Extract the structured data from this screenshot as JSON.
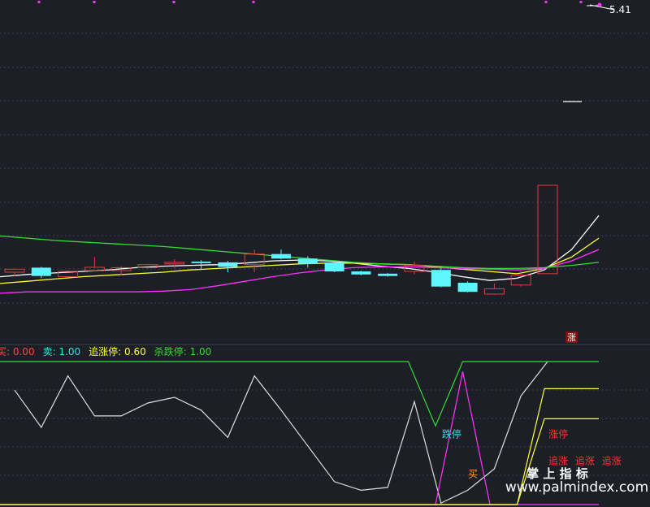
{
  "chart_data": [
    {
      "type": "candlestick",
      "price_label": "5.41",
      "limit_up_badge": "涨",
      "candles": [
        {
          "o": 0.0,
          "c": 0.4,
          "h": 0.5,
          "l": -0.5
        },
        {
          "o": 0.6,
          "c": -0.5,
          "h": 0.7,
          "l": -0.8
        },
        {
          "o": -0.6,
          "c": 0.1,
          "h": 0.25,
          "l": -0.7
        },
        {
          "o": 0.2,
          "c": 0.65,
          "h": 2.0,
          "l": 0.1
        },
        {
          "o": 0.2,
          "c": 0.6,
          "h": 0.8,
          "l": -0.4
        },
        {
          "o": 0.6,
          "c": 1.0,
          "h": 1.1,
          "l": 0.5
        },
        {
          "o": 1.1,
          "c": 1.3,
          "h": 1.7,
          "l": 0.5
        },
        {
          "o": 1.4,
          "c": 1.2,
          "h": 1.6,
          "l": 0.3
        },
        {
          "o": 1.3,
          "c": 0.7,
          "h": 1.5,
          "l": 0.0
        },
        {
          "o": 1.0,
          "c": 2.4,
          "h": 3.0,
          "l": 0.0
        },
        {
          "o": 2.4,
          "c": 1.8,
          "h": 3.0,
          "l": 1.7
        },
        {
          "o": 1.8,
          "c": 1.1,
          "h": 2.1,
          "l": 0.6
        },
        {
          "o": 1.3,
          "c": 0.1,
          "h": 1.4,
          "l": 0.0
        },
        {
          "o": 0.1,
          "c": -0.3,
          "h": 0.2,
          "l": -0.4
        },
        {
          "o": -0.2,
          "c": -0.5,
          "h": -0.1,
          "l": -0.6
        },
        {
          "o": 0.1,
          "c": 0.9,
          "h": 1.4,
          "l": -0.3
        },
        {
          "o": 0.3,
          "c": -1.9,
          "h": 0.6,
          "l": -2.0
        },
        {
          "o": -1.4,
          "c": -2.6,
          "h": -1.2,
          "l": -2.7
        },
        {
          "o": -2.9,
          "c": -2.2,
          "h": -1.5,
          "l": -3.0
        },
        {
          "o": -1.7,
          "c": -0.4,
          "h": 0.4,
          "l": -1.9
        },
        {
          "o": -0.2,
          "c": 11.5,
          "h": 11.5,
          "l": -0.2
        }
      ],
      "ma_lines": [
        {
          "color": "#ffffff",
          "values": [
            -0.6,
            -0.3,
            -0.1,
            0.1,
            0.3,
            0.6,
            0.8,
            0.9,
            1.0,
            1.2,
            1.5,
            1.6,
            1.5,
            1.2,
            0.8,
            0.5,
            0.0,
            -0.6,
            -1.1,
            -0.8,
            0.3,
            3.0,
            7.5
          ]
        },
        {
          "color": "#ffff33",
          "values": [
            -1.5,
            -1.2,
            -0.9,
            -0.6,
            -0.4,
            -0.2,
            0.0,
            0.3,
            0.5,
            0.7,
            0.9,
            1.1,
            1.2,
            1.2,
            1.1,
            1.0,
            0.7,
            0.4,
            0.1,
            -0.2,
            0.5,
            2.0,
            4.5
          ]
        },
        {
          "color": "#ff33ff",
          "values": [
            -2.8,
            -2.6,
            -2.6,
            -2.6,
            -2.6,
            -2.6,
            -2.5,
            -2.3,
            -1.8,
            -1.2,
            -0.6,
            -0.1,
            0.3,
            0.6,
            0.7,
            0.7,
            0.6,
            0.5,
            0.4,
            0.3,
            0.5,
            1.5,
            3.0
          ]
        },
        {
          "color": "#33dd33",
          "values": [
            4.8,
            4.5,
            4.2,
            4.0,
            3.8,
            3.6,
            3.4,
            3.1,
            2.8,
            2.5,
            2.2,
            1.9,
            1.6,
            1.3,
            1.1,
            1.0,
            0.8,
            0.6,
            0.5,
            0.5,
            0.6,
            0.9,
            1.3
          ]
        }
      ]
    },
    {
      "type": "line",
      "legend": [
        {
          "label": "买: 0.00",
          "color": "#ff4444"
        },
        {
          "label": "卖: 1.00",
          "color": "#33e0e0"
        },
        {
          "label": "追涨停: 0.60",
          "color": "#ffff44"
        },
        {
          "label": "杀跌停: 1.00",
          "color": "#33dd33"
        }
      ],
      "ylim": [
        0,
        1
      ],
      "series": [
        {
          "color": "#dddddd",
          "values": [
            0.8,
            0.54,
            0.9,
            0.62,
            0.62,
            0.71,
            0.75,
            0.66,
            0.47,
            0.9,
            0.66,
            0.41,
            0.16,
            0.1,
            0.12,
            0.72,
            0.01,
            0.1,
            0.25,
            0.76,
            1.0
          ]
        },
        {
          "color": "#33dd33",
          "values": [
            1,
            1,
            1,
            1,
            1,
            1,
            1,
            1,
            1,
            1,
            1,
            1,
            1,
            1,
            1,
            1,
            0.55,
            1,
            1,
            1,
            1,
            1,
            1
          ]
        },
        {
          "color": "#ff33ff",
          "values": [
            0,
            0,
            0,
            0,
            0,
            0,
            0,
            0,
            0,
            0,
            0,
            0,
            0,
            0,
            0,
            0,
            0,
            0.93,
            0,
            0,
            0,
            0,
            0
          ]
        },
        {
          "color": "#ffff44",
          "values": [
            0,
            0,
            0,
            0,
            0,
            0,
            0,
            0,
            0,
            0,
            0,
            0,
            0,
            0,
            0,
            0,
            0,
            0,
            0,
            0,
            0.6,
            0.6,
            0.6
          ]
        },
        {
          "color": "#ffff44",
          "values": [
            0,
            0,
            0,
            0,
            0,
            0,
            0,
            0,
            0,
            0,
            0,
            0,
            0,
            0,
            0,
            0,
            0,
            0,
            0,
            0,
            0.81,
            0.81,
            0.81
          ]
        }
      ],
      "annotations": [
        {
          "text": "跌停",
          "color": "#33e0e0",
          "i": 16.4,
          "v": 0.47
        },
        {
          "text": "涨停",
          "color": "#ff3333",
          "i": 20.4,
          "v": 0.47
        },
        {
          "text": "追涨",
          "color": "#ff3333",
          "i": 20.4,
          "v": 0.28
        },
        {
          "text": "追涨",
          "color": "#ff3333",
          "i": 21.4,
          "v": 0.28
        },
        {
          "text": "追涨",
          "color": "#ff3333",
          "i": 22.4,
          "v": 0.28
        },
        {
          "text": "买",
          "color": "#ff9933",
          "i": 17.2,
          "v": 0.19
        }
      ]
    }
  ],
  "watermark": {
    "title": "掌 上 指 标",
    "url": "www.palmindex.com"
  }
}
